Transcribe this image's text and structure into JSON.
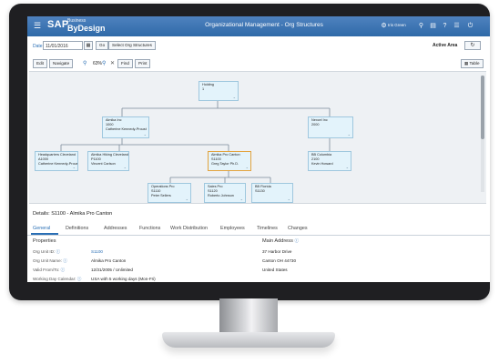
{
  "shell": {
    "brand": "SAP",
    "brand_sub": "Business",
    "brand_product": "ByDesign",
    "title": "Organizational Management - Org Structures",
    "user": "Iris Green",
    "icons": [
      "menu-icon",
      "settings-icon",
      "search-icon",
      "document-icon",
      "help-icon",
      "list-icon",
      "power-icon"
    ]
  },
  "toolbar": {
    "date_label": "Date",
    "date_value": "11/01/2016",
    "go_label": "Go",
    "select_org_label": "Select Org Structures",
    "active_area_label": "Active Area",
    "edit_label": "Edit",
    "navigate_label": "Navigate",
    "zoom_value": "63%",
    "find_label": "Find",
    "print_label": "Print",
    "table_label": "Table"
  },
  "org_nodes": [
    {
      "id": "holding",
      "line1": "Holding",
      "line2": "1",
      "line3": "",
      "selected": false
    },
    {
      "id": "almika-inc",
      "line1": "Almika Inc",
      "line2": "1000",
      "line3": "Catherine Kennedy-Proust",
      "selected": false
    },
    {
      "id": "nexcel-inc",
      "line1": "Nexcel Inc",
      "line2": "2000",
      "line3": "",
      "selected": false
    },
    {
      "id": "headquarters-cleveland",
      "line1": "Headquarters Cleveland",
      "line2": "A1000",
      "line3": "Catherine Kennedy-Proust",
      "selected": false
    },
    {
      "id": "almika-hiking-cleveland",
      "line1": "Almika Hiking Cleveland",
      "line2": "P1100",
      "line3": "Vincent Carlson",
      "selected": false
    },
    {
      "id": "almika-pro-canton",
      "line1": "Almika Pro Canton",
      "line2": "S1100",
      "line3": "Greg Taylor Ph.D.",
      "selected": true
    },
    {
      "id": "bb-columbia",
      "line1": "BB Columbia",
      "line2": "2100",
      "line3": "Kevin Howard",
      "selected": false
    },
    {
      "id": "operations-pro",
      "line1": "Operations Pro",
      "line2": "S1110",
      "line3": "Peter Sellers",
      "selected": false
    },
    {
      "id": "sales-pro",
      "line1": "Sales Pro",
      "line2": "S1120",
      "line3": "Roberto Johnson",
      "selected": false
    },
    {
      "id": "bb-florida",
      "line1": "BB Florida",
      "line2": "S1130",
      "line3": "",
      "selected": false
    }
  ],
  "details": {
    "title": "Details: S1100 - Almika Pro Canton",
    "tabs": [
      "General",
      "Definitions",
      "Addresses",
      "Functions",
      "Work Distribution",
      "Employees",
      "Timelines",
      "Changes"
    ],
    "active_tab": "General",
    "properties_title": "Properties",
    "fields": [
      {
        "label": "Org Unit ID:",
        "value": "S1100"
      },
      {
        "label": "Org Unit Name:",
        "value": "Almika Pro Canton"
      },
      {
        "label": "Valid From/To:",
        "value": "12/31/2005 / Unlimited"
      },
      {
        "label": "Working Day Calendar:",
        "value": "USA with 5 working days (Mon-Fri)"
      }
    ],
    "main_address_title": "Main Address",
    "address_lines": [
      "37 Harbor Drive",
      "Canton OH 44730",
      "United States"
    ]
  },
  "colors": {
    "shell_blue": "#2f6aa8",
    "node_fill": "#e3f3fb",
    "selected_border": "#e3a33d",
    "link_blue": "#2a6fb5"
  }
}
